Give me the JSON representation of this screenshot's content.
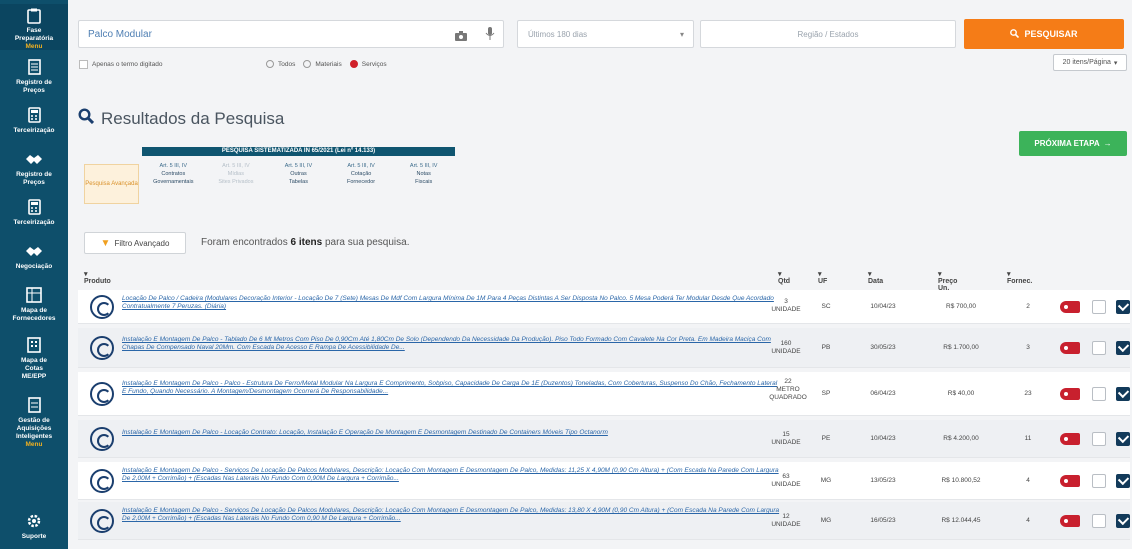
{
  "sidebar": {
    "items": [
      {
        "label": "Fase\nPreparatória",
        "sub": "Menu",
        "icon": "clipboard-icon"
      },
      {
        "label": "Registro de\nPreços",
        "sub": "",
        "icon": "document-icon"
      },
      {
        "label": "Terceirização",
        "sub": "",
        "icon": "calculator-icon"
      },
      {
        "label": "Registro de\nPreços",
        "sub": "",
        "icon": "handshake-icon"
      },
      {
        "label": "Terceirização",
        "sub": "",
        "icon": "calculator-icon"
      },
      {
        "label": "Negociação",
        "sub": "",
        "icon": "handshake-icon"
      },
      {
        "label": "Mapa de\nFornecedores",
        "sub": "",
        "icon": "map-icon"
      },
      {
        "label": "Mapa de\nCotas\nME/EPP",
        "sub": "",
        "icon": "building-icon"
      },
      {
        "label": "Gestão de\nAquisições\nInteligentes",
        "sub": "Menu",
        "icon": "report-icon"
      },
      {
        "label": "Suporte",
        "sub": "",
        "icon": "gear-icon"
      }
    ]
  },
  "search": {
    "value": "Palco Modular",
    "period_placeholder": "Últimos 180 dias",
    "region_placeholder": "Região / Estados",
    "button_label": "PESQUISAR"
  },
  "options": {
    "exact_term": "Apenas o termo digitado",
    "all": "Todos",
    "materials": "Materiais",
    "services": "Serviços",
    "per_page": "20 itens/Página"
  },
  "results": {
    "title": "Resultados da Pesquisa",
    "next_step": "PRÓXIMA ETAPA",
    "step_left": "Pesquisa Avançada",
    "step_head": "PESQUISA SISTEMATIZADA IN 65/2021 (Lei nº 14.133)",
    "steps": [
      {
        "ref": "Art. 5 III, IV",
        "line1": "Contratos",
        "line2": "Governamentais",
        "dim": false
      },
      {
        "ref": "Art. 5 III, IV",
        "line1": "Mídias",
        "line2": "Sites Privados",
        "dim": true
      },
      {
        "ref": "Art. 5 III, IV",
        "line1": "Outras",
        "line2": "Tabelas",
        "dim": false
      },
      {
        "ref": "Art. 5 III, IV",
        "line1": "Cotação",
        "line2": "Fornecedor",
        "dim": false
      },
      {
        "ref": "Art. 5 III, IV",
        "line1": "Notas",
        "line2": "Fiscais",
        "dim": false
      }
    ],
    "filter_label": "Filtro Avançado",
    "found_prefix": "Foram encontrados",
    "found_count": "6 itens",
    "found_suffix": "para sua pesquisa."
  },
  "table": {
    "headers": {
      "product": "Produto",
      "qty": "Qtd",
      "uf": "UF",
      "date": "Data",
      "price": "Preço Un.",
      "supplier": "Fornec."
    },
    "rows": [
      {
        "desc": "Locação De Palco / Cadeira (Modulares Decoração Interior - Locação De 7 (Sete) Mesas De Mdf Com Largura Mínima De 1M Para 4 Peças Distintas A Ser Disposta No Palco. 5 Mesa Poderá Ter Modular Desde Que Acordado Contratualmente 7 Peruzas. (Diária)",
        "qty": "3\nUNIDADE",
        "uf": "SC",
        "date": "10/04/23",
        "price": "R$ 700,00",
        "supplier": "2"
      },
      {
        "desc": "Instalação E Montagem De Palco - Tablado De 6 Mt Metros Com Piso De 0,90Cm Até 1,80Cm De Solo (Dependendo Da Necessidade Da Produção). Piso Todo Formado Com Cavalete Na Cor Preta. Em Madeira Maciça Com Chapas De Compensado Naval 20Mm. Com Escada De Acesso E Rampa De Acessibilidade De...",
        "qty": "160\nUNIDADE",
        "uf": "PB",
        "date": "30/05/23",
        "price": "R$ 1.700,00",
        "supplier": "3"
      },
      {
        "desc": "Instalação E Montagem De Palco - Palco - Estrutura De Ferro/Metal Modular Na Largura E Comprimento, Sobpiso, Capacidade De Carga De 1E (Duzentos) Toneladas, Com Coberturas, Suspenso Do Chão, Fechamento Lateral E Fundo, Quando Necessário. A Montagem/Desmontagem Ocorrerá De Responsabilidade...",
        "qty": "22\nMETRO\nQUADRADO",
        "uf": "SP",
        "date": "06/04/23",
        "price": "R$ 40,00",
        "supplier": "23"
      },
      {
        "desc": "Instalação E Montagem De Palco - Locação Contrato: Locação, Instalação E Operação De Montagem E Desmontagem Destinado De Containers Móveis Tipo Octanorm",
        "qty": "15\nUNIDADE",
        "uf": "PE",
        "date": "10/04/23",
        "price": "R$ 4.200,00",
        "supplier": "11"
      },
      {
        "desc": "Instalação E Montagem De Palco - Serviços De Locação De Palcos Modulares, Descrição: Locação Com Montagem E Desmontagem De Palco, Medidas: 11,25 X 4,90M (0,90 Cm Altura) + (Com Escada Na Parede Com Largura De 2,00M + Corrimão) + (Escadas Nas Laterais No Fundo Com 0,90M De Largura + Corrimão...",
        "qty": "63\nUNIDADE",
        "uf": "MG",
        "date": "13/05/23",
        "price": "R$ 10.800,52",
        "supplier": "4"
      },
      {
        "desc": "Instalação E Montagem De Palco - Serviços De Locação De Palcos Modulares, Descrição: Locação Com Montagem E Desmontagem De Palco, Medidas: 13,80 X 4,90M (0,90 Cm Altura) + (Com Escada Na Parede Com Largura De 2,00M + Corrimão) + (Escadas Nas Laterais No Fundo Com 0,90 M De Largura + Corrimão...",
        "qty": "12\nUNIDADE",
        "uf": "MG",
        "date": "16/05/23",
        "price": "R$ 12.044,45",
        "supplier": "4"
      }
    ]
  }
}
